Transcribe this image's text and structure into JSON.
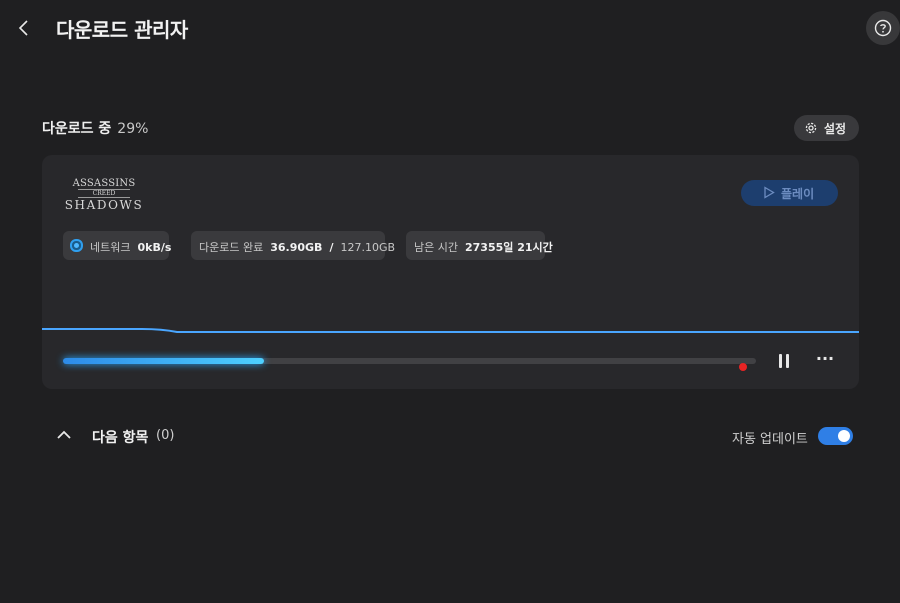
{
  "header": {
    "title": "다운로드 관리자",
    "back_icon": "chevron-left-icon",
    "help_icon": "question-circle-icon"
  },
  "status": {
    "label": "다운로드 중",
    "percent_text": "29%",
    "settings_label": "설정",
    "settings_icon": "gear-icon"
  },
  "game": {
    "logo_line1": "ASSASSINS",
    "logo_line2": "CREED",
    "logo_line3": "SHADOWS",
    "play_label": "플레이",
    "play_icon": "play-icon"
  },
  "stats": {
    "network_label": "네트워크",
    "network_value": "0kB/s",
    "downloaded_label": "다운로드 완료",
    "downloaded_value": "36.90GB",
    "separator": "/",
    "total_value": "127.10GB",
    "remaining_label": "남은 시간",
    "remaining_value": "27355일 21시간"
  },
  "progress": {
    "fraction": 0.29,
    "pause_icon": "pause-icon",
    "more_icon": "more-horizontal-icon",
    "more_glyph": "···"
  },
  "queue": {
    "title": "다음 항목",
    "count_text": "(0)",
    "chevron_icon": "chevron-up-icon",
    "auto_update_label": "자동 업데이트",
    "auto_update_on": true
  },
  "colors": {
    "accent": "#2f7fe6",
    "progress_fill": "#4ed0ff",
    "record_dot": "#e82424",
    "play_button": "#1d3e6e"
  }
}
